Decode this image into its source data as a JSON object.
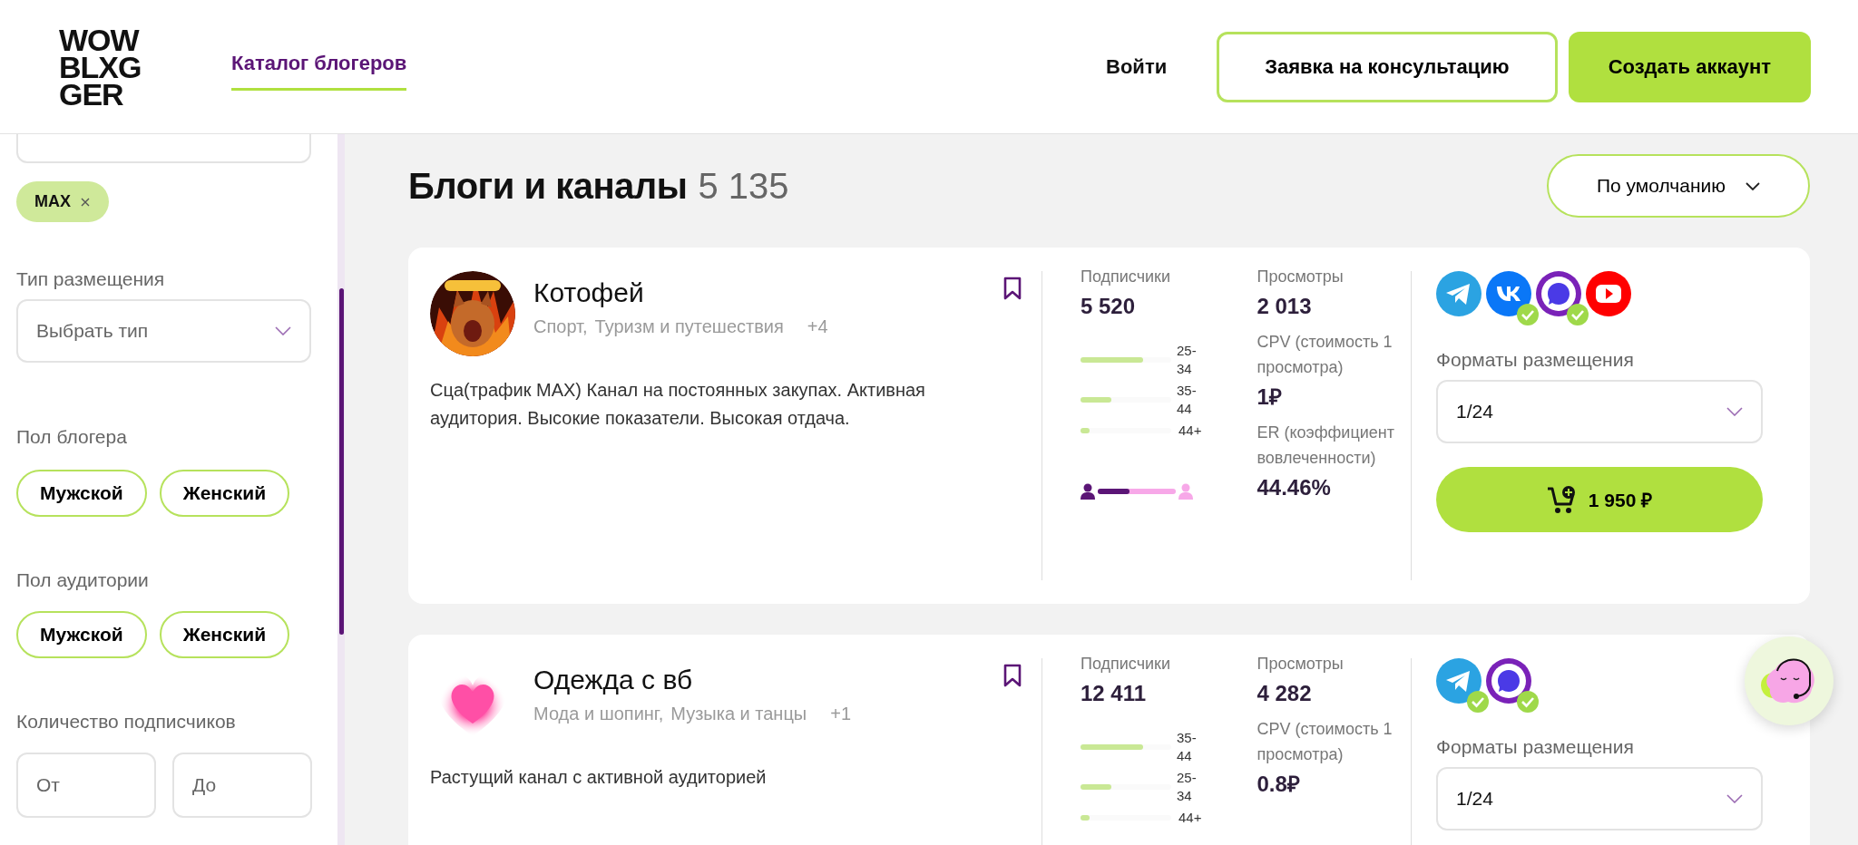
{
  "header": {
    "logo": [
      "WOW",
      "BLXG",
      "GER"
    ],
    "nav": [
      {
        "label": "Каталог блогеров",
        "selected": true
      }
    ],
    "login": "Войти",
    "consult": "Заявка на консультацию",
    "signup": "Создать аккаунт"
  },
  "filters": {
    "chips": [
      {
        "label": "MAX"
      }
    ],
    "placement": {
      "label": "Тип размещения",
      "placeholder": "Выбрать тип"
    },
    "groups": [
      {
        "label": "Пол блогера",
        "options": [
          {
            "label": "Мужской",
            "selected": false
          },
          {
            "label": "Женский",
            "selected": false
          }
        ]
      },
      {
        "label": "Пол аудитории",
        "options": [
          {
            "label": "Мужской",
            "selected": false
          },
          {
            "label": "Женский",
            "selected": false
          }
        ]
      }
    ],
    "subscribers": {
      "label": "Количество подписчиков",
      "from": {
        "placeholder": "От"
      },
      "to": {
        "placeholder": "До"
      }
    }
  },
  "catalog": {
    "title": "Блоги и каналы",
    "count": "5 135",
    "sort": "По умолчанию"
  },
  "cards": [
    {
      "avatar": {
        "kind": "picture"
      },
      "name": "Котофей",
      "tags": [
        "Спорт,",
        "Туризм и путешествия"
      ],
      "more": "+4",
      "saved": false,
      "description": "Сца(трафик MAX) Канал на постоянных закупах. Активная аудитория. Высокие показатели. Высокая отдача.",
      "subscribers_label": "Подписчики",
      "subscribers": "5 520",
      "ages": [
        {
          "label": "25-34",
          "level": 0.69
        },
        {
          "label": "35-44",
          "level": 0.34
        },
        {
          "label": "44+",
          "level": 0.1
        }
      ],
      "gender": {
        "level": 0.41
      },
      "metrics": [
        {
          "label": "Просмотры",
          "value": "2 013"
        },
        {
          "label": "CPV (стоимость 1 просмотра)",
          "value": "1₽"
        },
        {
          "label": "ER (коэффициент вовлеченности)",
          "value": "44.46%"
        }
      ],
      "socials": [
        {
          "kind": "telegram",
          "verified": false
        },
        {
          "kind": "vk",
          "verified": true
        },
        {
          "kind": "max",
          "verified": true
        },
        {
          "kind": "youtube",
          "verified": false
        }
      ],
      "formats_label": "Форматы размещения",
      "format": "1/24",
      "price": "1 950 ₽"
    },
    {
      "avatar": {
        "kind": "heart"
      },
      "name": "Одежда с вб",
      "tags": [
        "Мода и шопинг,",
        "Музыка и танцы"
      ],
      "more": "+1",
      "saved": false,
      "description": "Растущий канал с активной аудиторией",
      "subscribers_label": "Подписчики",
      "subscribers": "12 411",
      "ages": [
        {
          "label": "35-44",
          "level": 0.69
        },
        {
          "label": "25-34",
          "level": 0.34
        },
        {
          "label": "44+",
          "level": 0.1
        }
      ],
      "metrics": [
        {
          "label": "Просмотры",
          "value": "4 282"
        },
        {
          "label": "CPV (стоимость 1 просмотра)",
          "value": "0.8₽"
        }
      ],
      "socials": [
        {
          "kind": "telegram",
          "verified": true
        },
        {
          "kind": "max",
          "verified": true
        }
      ],
      "formats_label": "Форматы размещения",
      "format": "1/24"
    }
  ]
}
